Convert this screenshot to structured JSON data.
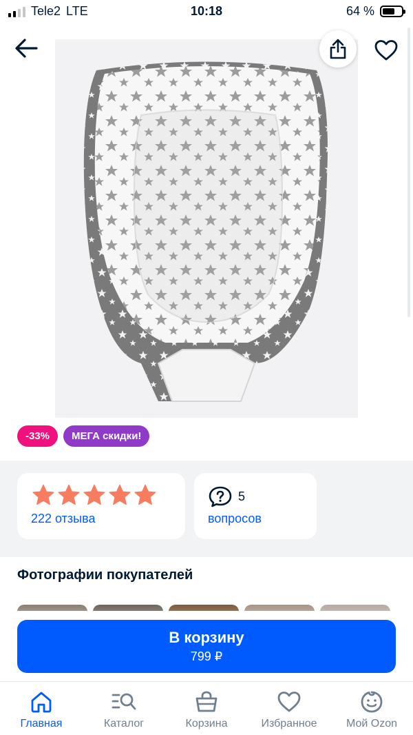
{
  "status_bar": {
    "carrier": "Tele2",
    "network": "LTE",
    "time": "10:18",
    "battery": "64 %",
    "battery_level": 0.64
  },
  "nav": {
    "back_icon": "arrow-left-icon",
    "share_icon": "share-icon",
    "favorite_icon": "heart-icon"
  },
  "product": {
    "image_description_icon": "baby-nest-photo"
  },
  "badges": {
    "discount": "-33%",
    "promo": "МЕГА скидки!"
  },
  "rating": {
    "stars": 5,
    "reviews_label": "222 отзыва"
  },
  "questions": {
    "count": "5",
    "label": "вопросов"
  },
  "customer_photos": {
    "title": "Фотографии покупателей"
  },
  "cart": {
    "label": "В корзину",
    "price": "799 ₽"
  },
  "tabbar": {
    "items": [
      {
        "label": "Главная",
        "icon": "home-icon",
        "active": true
      },
      {
        "label": "Каталог",
        "icon": "catalog-search-icon",
        "active": false
      },
      {
        "label": "Корзина",
        "icon": "cart-icon",
        "active": false
      },
      {
        "label": "Избранное",
        "icon": "heart-icon",
        "active": false
      },
      {
        "label": "Мой Ozon",
        "icon": "profile-icon",
        "active": false
      }
    ]
  },
  "colors": {
    "accent": "#005bff",
    "discount": "#f1117e",
    "promo": "#8f3bc7",
    "star": "#f77d61"
  }
}
